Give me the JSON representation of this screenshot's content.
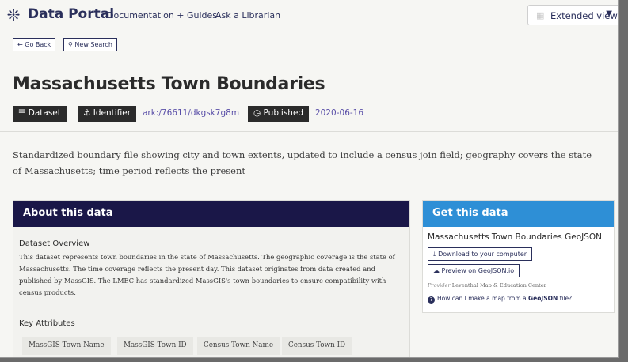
{
  "nav": {
    "brand": "Data Portal",
    "links": [
      "Documentation + Guides",
      "Ask a Librarian"
    ],
    "view_toggle": "Extended view"
  },
  "actions": {
    "go_back": "Go Back",
    "new_search": "New Search"
  },
  "record": {
    "title": "Massachusetts Town Boundaries",
    "type_badge": "Dataset",
    "identifier_badge": "Identifier",
    "identifier_value": "ark:/76611/dkgsk7g8m",
    "published_badge": "Published",
    "published_value": "2020-06-16",
    "description": "Standardized boundary file showing city and town extents, updated to include a census join field; geography covers the state of Massachusetts; time period reflects the present"
  },
  "about": {
    "heading": "About this data",
    "overview_title": "Dataset Overview",
    "overview_text": "This dataset represents town boundaries in the state of Massachusetts. The geographic coverage is the state of Massachusetts. The time coverage reflects the present day. This dataset originates from data created and published by MassGIS. The LMEC has standardized MassGIS's town boundaries to ensure compatibility with census products.",
    "key_attributes_title": "Key Attributes",
    "key_attributes": [
      "MassGIS Town Name",
      "MassGIS Town ID",
      "Census Town Name",
      "Census Town ID"
    ]
  },
  "get": {
    "heading": "Get this data",
    "file_title": "Massachusetts Town Boundaries GeoJSON",
    "download_label": "Download to your computer",
    "preview_label": "Preview on GeoJSON.io",
    "provider_label": "Provider",
    "provider_value": "Leventhal Map & Education Center",
    "help_prefix": "How can I make a map from a ",
    "help_bold": "GeoJSON",
    "help_suffix": " file?"
  },
  "colors": {
    "navy": "#2a2f5b",
    "about_header": "#1a1748",
    "get_header": "#2e8fd6",
    "badge_bg": "#2b2b2b",
    "link_purple": "#5a4fa8"
  }
}
